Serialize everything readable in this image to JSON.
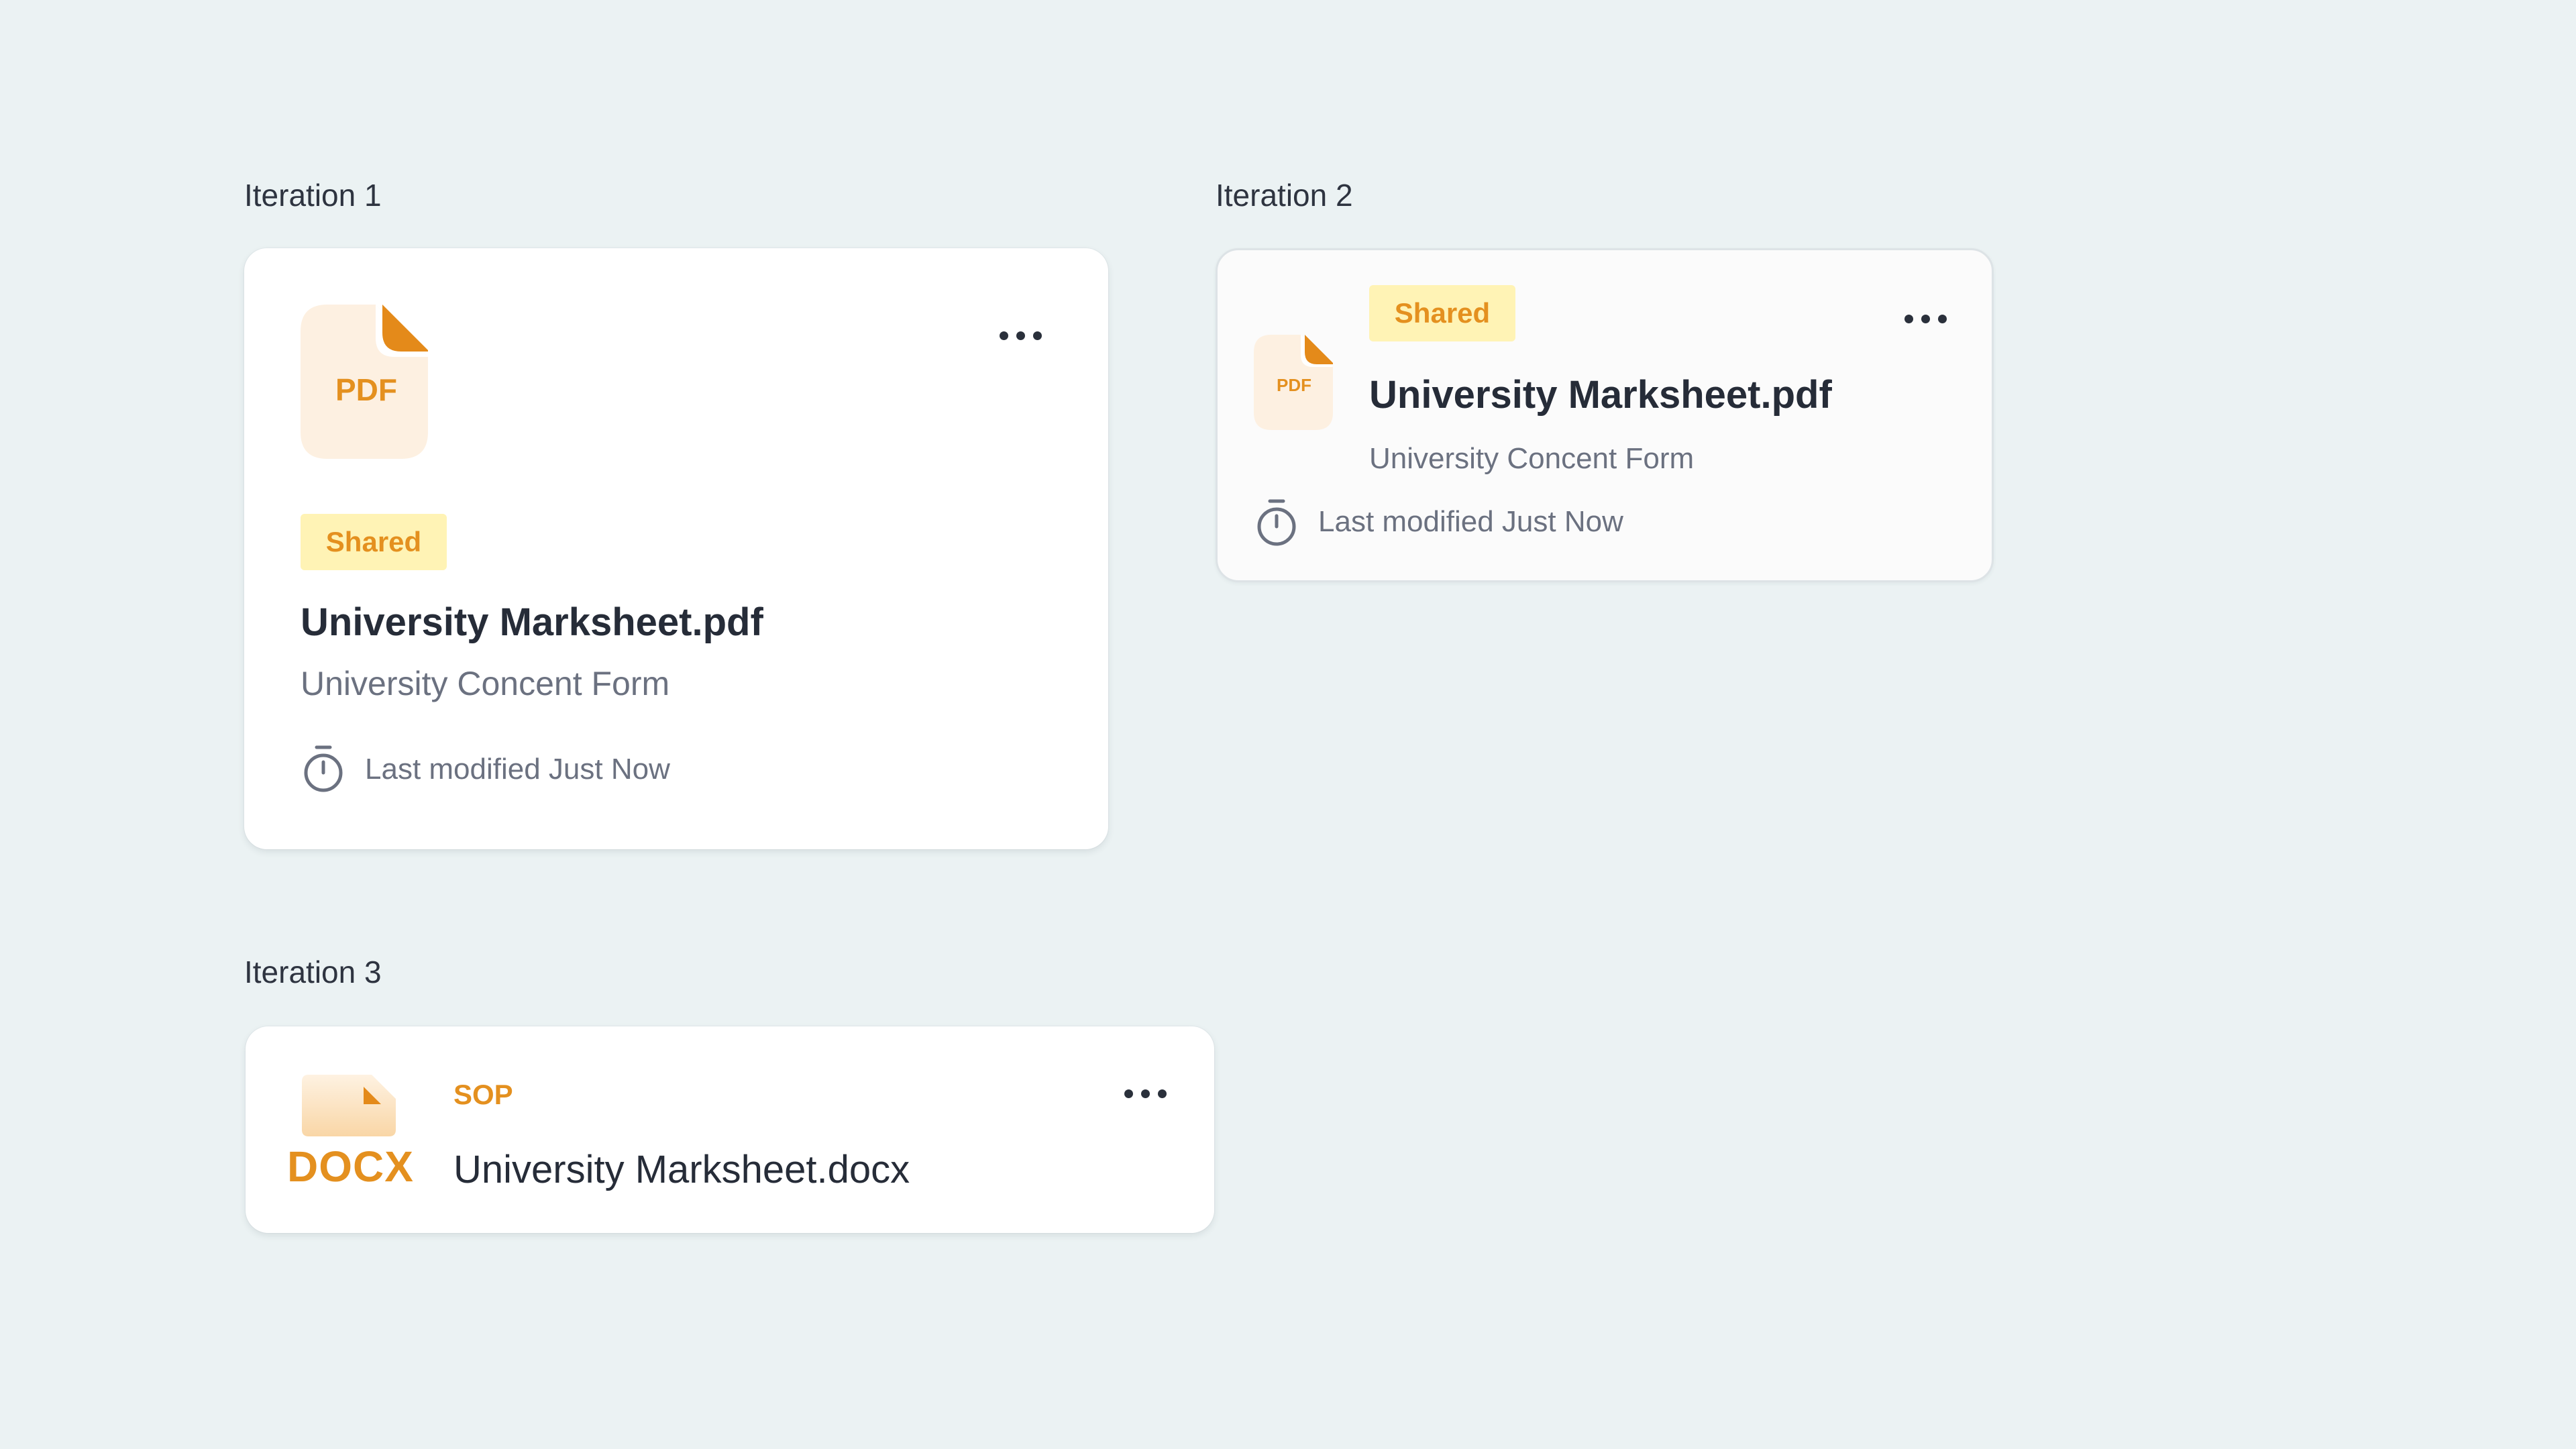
{
  "iterations": [
    {
      "label": "Iteration 1",
      "file_type": "PDF",
      "badge": "Shared",
      "title": "University Marksheet.pdf",
      "subtitle": "University Concent Form",
      "modified": "Last modified Just Now",
      "menu_icon": "more-horizontal-icon",
      "time_icon": "timer-icon"
    },
    {
      "label": "Iteration 2",
      "file_type": "PDF",
      "badge": "Shared",
      "title": "University Marksheet.pdf",
      "subtitle": "University Concent Form",
      "modified": "Last modified Just Now",
      "menu_icon": "more-horizontal-icon",
      "time_icon": "timer-icon"
    },
    {
      "label": "Iteration 3",
      "file_type": "DOCX",
      "category": "SOP",
      "title": "University Marksheet.docx",
      "menu_icon": "more-horizontal-icon"
    }
  ],
  "colors": {
    "background": "#EBF2F3",
    "accent_orange": "#E4901F",
    "badge_bg": "#FFF3B5",
    "file_icon_bg": "#FDF0E1",
    "title_text": "#262C38",
    "muted_text": "#6B7180"
  }
}
